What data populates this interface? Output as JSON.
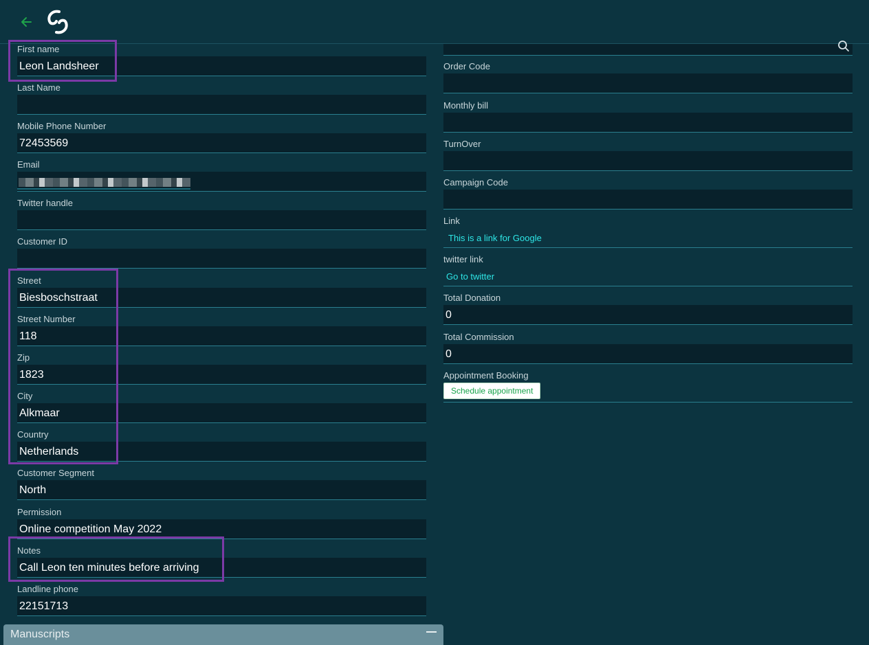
{
  "left_fields": [
    {
      "label": "First name",
      "value": "Leon Landsheer"
    },
    {
      "label": "Last Name",
      "value": ""
    },
    {
      "label": "Mobile Phone Number",
      "value": "72453569"
    },
    {
      "label": "Email",
      "value": ""
    },
    {
      "label": "Twitter handle",
      "value": ""
    },
    {
      "label": "Customer ID",
      "value": ""
    },
    {
      "label": "Street",
      "value": "Biesboschstraat"
    },
    {
      "label": "Street Number",
      "value": "118"
    },
    {
      "label": "Zip",
      "value": "1823"
    },
    {
      "label": "City",
      "value": "Alkmaar"
    },
    {
      "label": "Country",
      "value": "Netherlands"
    },
    {
      "label": "Customer Segment",
      "value": "North"
    },
    {
      "label": "Permission",
      "value": "Online competition May 2022"
    },
    {
      "label": "Notes",
      "value": "Call Leon ten minutes before arriving"
    },
    {
      "label": "Landline phone",
      "value": "22151713"
    }
  ],
  "right_fields": [
    {
      "label": "Order Code",
      "value": ""
    },
    {
      "label": "Monthly bill",
      "value": ""
    },
    {
      "label": "TurnOver",
      "value": ""
    },
    {
      "label": "Campaign Code",
      "value": ""
    },
    {
      "label": "Link",
      "link_text": "This is a link for Google"
    },
    {
      "label": "twitter link",
      "link_text": "Go to twitter"
    },
    {
      "label": "Total Donation",
      "value": "0"
    },
    {
      "label": "Total Commission",
      "value": "0"
    },
    {
      "label": "Appointment Booking",
      "button_label": "Schedule appointment"
    }
  ],
  "icons": {
    "back": "arrow-left-icon",
    "logo": "brand-logo-icon",
    "search": "search-icon"
  },
  "colors": {
    "background": "#0c3440",
    "input_bg": "#08212b",
    "highlight": "#7b3aa6",
    "link": "#2ee6e6",
    "back_arrow": "#1fa34a"
  },
  "panel": {
    "title": "Manuscripts"
  }
}
